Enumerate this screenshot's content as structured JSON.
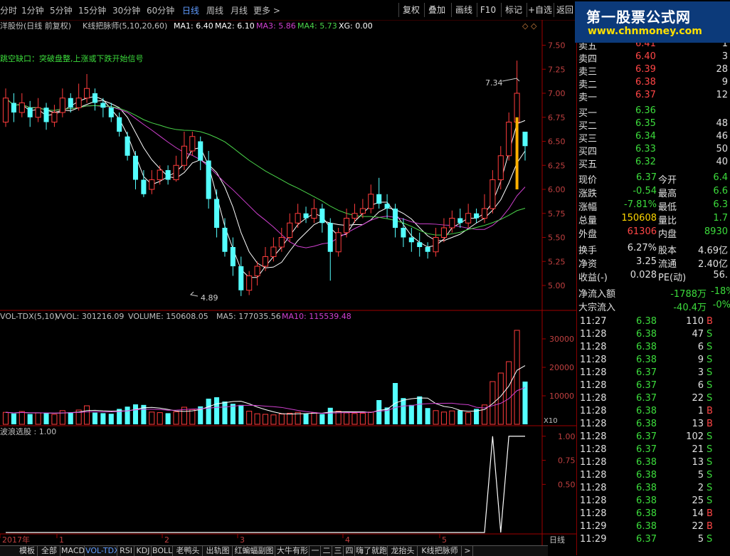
{
  "toolbar": {
    "periods": [
      "分时",
      "1分钟",
      "5分钟",
      "15分钟",
      "30分钟",
      "60分钟",
      "日线",
      "周线",
      "月线",
      "更多 >"
    ],
    "active_period": "日线",
    "buttons": [
      "复权",
      "叠加",
      "画线",
      "F10",
      "标记",
      "+自选",
      "返回"
    ]
  },
  "watermark": {
    "title": "第一股票公式网",
    "url": "www.chnmoney.com"
  },
  "main_chart": {
    "title": "洋股份(日线 前复权)",
    "indicator": "K线把脉师(5,10,20,60)",
    "ma": [
      {
        "label": "MA1: 6.40",
        "color": "#ffffff"
      },
      {
        "label": "MA2: 6.10",
        "color": "#ffffff"
      },
      {
        "label": "MA3: 5.86",
        "color": "#d040d0"
      },
      {
        "label": "MA4: 5.73",
        "color": "#4ad44a"
      },
      {
        "label": "XG: 0.00",
        "color": "#ffffff"
      }
    ],
    "signal_text": "跳空缺口：突破盘整,上涨或下跌开始信号",
    "high_label": "7.34",
    "low_label": "4.89",
    "y_ticks": [
      "7.50",
      "7.25",
      "7.00",
      "6.75",
      "6.50",
      "6.25",
      "6.00",
      "5.75",
      "5.50",
      "5.25",
      "5.00"
    ]
  },
  "chart_data": [
    {
      "type": "candlestick",
      "title": "洋股份(日线 前复权)",
      "ylim": [
        4.8,
        7.6
      ],
      "annotations": [
        {
          "text": "7.34",
          "value": 7.34
        },
        {
          "text": "4.89",
          "value": 4.89
        }
      ],
      "candles": [
        [
          6.7,
          6.95,
          7.05,
          6.65
        ],
        [
          6.9,
          6.8,
          7.0,
          6.7
        ],
        [
          6.8,
          6.9,
          7.0,
          6.75
        ],
        [
          6.85,
          6.75,
          6.92,
          6.65
        ],
        [
          6.75,
          6.85,
          6.95,
          6.7
        ],
        [
          6.85,
          6.7,
          6.9,
          6.62
        ],
        [
          6.7,
          6.8,
          6.88,
          6.65
        ],
        [
          6.8,
          6.95,
          7.05,
          6.75
        ],
        [
          6.95,
          6.85,
          7.0,
          6.8
        ],
        [
          6.85,
          6.95,
          7.1,
          6.82
        ],
        [
          6.95,
          7.05,
          7.2,
          6.9
        ],
        [
          7.0,
          6.9,
          7.05,
          6.82
        ],
        [
          6.9,
          6.85,
          6.95,
          6.75
        ],
        [
          6.85,
          6.75,
          6.9,
          6.7
        ],
        [
          6.75,
          6.6,
          6.8,
          6.55
        ],
        [
          6.55,
          6.35,
          6.6,
          6.3
        ],
        [
          6.35,
          6.1,
          6.4,
          6.0
        ],
        [
          6.1,
          5.95,
          6.2,
          5.92
        ],
        [
          6.0,
          6.1,
          6.2,
          5.95
        ],
        [
          6.1,
          6.2,
          6.25,
          6.05
        ],
        [
          6.2,
          6.1,
          6.25,
          6.05
        ],
        [
          6.1,
          6.25,
          6.35,
          6.08
        ],
        [
          6.25,
          6.45,
          6.6,
          6.2
        ],
        [
          6.4,
          6.55,
          6.6,
          6.35
        ],
        [
          6.5,
          6.3,
          6.55,
          6.2
        ],
        [
          6.3,
          5.9,
          6.4,
          5.8
        ],
        [
          5.9,
          5.6,
          6.0,
          5.5
        ],
        [
          5.6,
          5.35,
          5.7,
          5.3
        ],
        [
          5.4,
          5.2,
          5.5,
          5.1
        ],
        [
          5.2,
          4.95,
          5.3,
          4.89
        ],
        [
          4.95,
          5.1,
          5.15,
          4.9
        ],
        [
          5.1,
          5.2,
          5.25,
          5.0
        ],
        [
          5.2,
          5.3,
          5.4,
          5.15
        ],
        [
          5.3,
          5.4,
          5.5,
          5.25
        ],
        [
          5.4,
          5.5,
          5.6,
          5.35
        ],
        [
          5.5,
          5.65,
          5.75,
          5.45
        ],
        [
          5.65,
          5.75,
          5.85,
          5.6
        ],
        [
          5.75,
          5.7,
          5.82,
          5.65
        ],
        [
          5.7,
          5.8,
          5.9,
          5.65
        ],
        [
          5.8,
          5.65,
          5.85,
          5.55
        ],
        [
          5.65,
          5.35,
          5.7,
          5.05
        ],
        [
          5.35,
          5.55,
          5.6,
          5.3
        ],
        [
          5.55,
          5.7,
          5.8,
          5.5
        ],
        [
          5.7,
          5.75,
          5.85,
          5.65
        ],
        [
          5.75,
          5.8,
          5.9,
          5.7
        ],
        [
          5.8,
          5.95,
          6.05,
          5.75
        ],
        [
          5.95,
          5.85,
          6.12,
          5.8
        ],
        [
          5.85,
          5.8,
          5.95,
          5.7
        ],
        [
          5.8,
          5.6,
          5.85,
          5.5
        ],
        [
          5.6,
          5.5,
          5.7,
          5.4
        ],
        [
          5.5,
          5.45,
          5.6,
          5.35
        ],
        [
          5.45,
          5.4,
          5.55,
          5.3
        ],
        [
          5.4,
          5.35,
          5.45,
          5.28
        ],
        [
          5.35,
          5.5,
          5.6,
          5.3
        ],
        [
          5.5,
          5.6,
          5.7,
          5.45
        ],
        [
          5.6,
          5.7,
          5.78,
          5.55
        ],
        [
          5.7,
          5.65,
          5.8,
          5.6
        ],
        [
          5.65,
          5.75,
          5.85,
          5.6
        ],
        [
          5.75,
          5.7,
          5.8,
          5.65
        ],
        [
          5.7,
          5.8,
          5.95,
          5.65
        ],
        [
          5.8,
          6.1,
          6.2,
          5.75
        ],
        [
          6.1,
          6.35,
          6.45,
          6.0
        ],
        [
          6.35,
          6.7,
          6.8,
          6.3
        ],
        [
          6.7,
          7.0,
          7.34,
          6.7
        ],
        [
          6.6,
          6.45,
          6.6,
          6.3
        ]
      ]
    },
    {
      "type": "bar",
      "title": "VOL-TDX(5,10)",
      "labels": {
        "vol": "VVOL: 301216.09",
        "volume": "VOLUME: 150608.05",
        "ma5": "MA5: 177035.56",
        "ma10": "MA10: 115539.48"
      },
      "ylim": [
        0,
        35000
      ],
      "y_ticks": [
        "30000",
        "20000",
        "10000"
      ],
      "unit": "X10",
      "values": [
        4200,
        3800,
        4500,
        3600,
        4000,
        3900,
        3500,
        4800,
        4200,
        5000,
        6500,
        4100,
        3900,
        3700,
        5400,
        6200,
        7000,
        6800,
        4300,
        4100,
        3900,
        4400,
        6000,
        5200,
        6300,
        9000,
        9500,
        8000,
        7200,
        6800,
        4600,
        3700,
        3500,
        3300,
        3600,
        3900,
        4200,
        3800,
        4100,
        3600,
        5800,
        4600,
        4000,
        3800,
        3900,
        4300,
        8500,
        5900,
        14500,
        9200,
        6800,
        9800,
        5700,
        4800,
        4300,
        4700,
        4900,
        4100,
        5400,
        6800,
        15000,
        18000,
        22000,
        33000,
        15000
      ]
    },
    {
      "type": "line",
      "title": "波浪选股",
      "value_label": "波浪选股 : 1.00",
      "ylim": [
        0,
        1.05
      ],
      "y_ticks": [
        "1.00",
        "0.75",
        "0.50"
      ]
    }
  ],
  "axis_dates": [
    "2017年",
    "1",
    "2",
    "3",
    "4",
    "5"
  ],
  "axis_right_label": "日线",
  "right_panel": {
    "asks": [
      {
        "label": "卖五",
        "price": "6.41",
        "vol": "1"
      },
      {
        "label": "卖四",
        "price": "6.40",
        "vol": "3"
      },
      {
        "label": "卖三",
        "price": "6.39",
        "vol": "28"
      },
      {
        "label": "卖二",
        "price": "6.38",
        "vol": "9"
      },
      {
        "label": "卖一",
        "price": "6.37",
        "vol": "12"
      }
    ],
    "bids": [
      {
        "label": "买一",
        "price": "6.36",
        "vol": ""
      },
      {
        "label": "买二",
        "price": "6.35",
        "vol": "48"
      },
      {
        "label": "买三",
        "price": "6.34",
        "vol": "46"
      },
      {
        "label": "买四",
        "price": "6.33",
        "vol": "50"
      },
      {
        "label": "买五",
        "price": "6.32",
        "vol": "40"
      }
    ],
    "stats": [
      {
        "k1": "现价",
        "v1": "6.37",
        "k2": "今开",
        "v2": "6.4"
      },
      {
        "k1": "涨跌",
        "v1": "-0.54",
        "k2": "最高",
        "v2": "6.6"
      },
      {
        "k1": "涨幅",
        "v1": "-7.81%",
        "k2": "最低",
        "v2": "6.3"
      },
      {
        "k1": "总量",
        "v1": "150608",
        "k2": "量比",
        "v2": "1.7"
      },
      {
        "k1": "外盘",
        "v1": "61306",
        "k2": "内盘",
        "v2": "8930"
      }
    ],
    "stats2": [
      {
        "k1": "换手",
        "v1": "6.27%",
        "k2": "股本",
        "v2": "4.69亿"
      },
      {
        "k1": "净资",
        "v1": "3.25",
        "k2": "流通",
        "v2": "2.40亿"
      },
      {
        "k1": "收益(-)",
        "v1": "0.028",
        "k2": "PE(动)",
        "v2": "56."
      }
    ],
    "flows": [
      {
        "k": "净流入额",
        "v1": "-1788万",
        "v2": "-18%"
      },
      {
        "k": "大宗流入",
        "v1": "-40.4万",
        "v2": "-0%"
      }
    ],
    "ticks": [
      {
        "t": "11:27",
        "p": "6.38",
        "v": "110",
        "s": "B"
      },
      {
        "t": "11:28",
        "p": "6.38",
        "v": "47",
        "s": "S"
      },
      {
        "t": "11:28",
        "p": "6.38",
        "v": "6",
        "s": "S"
      },
      {
        "t": "11:28",
        "p": "6.38",
        "v": "9",
        "s": "S"
      },
      {
        "t": "11:28",
        "p": "6.37",
        "v": "3",
        "s": "S"
      },
      {
        "t": "11:28",
        "p": "6.37",
        "v": "6",
        "s": "S"
      },
      {
        "t": "11:28",
        "p": "6.37",
        "v": "22",
        "s": "S"
      },
      {
        "t": "11:28",
        "p": "6.38",
        "v": "1",
        "s": "B"
      },
      {
        "t": "11:28",
        "p": "6.38",
        "v": "13",
        "s": "B"
      },
      {
        "t": "11:28",
        "p": "6.37",
        "v": "102",
        "s": "S"
      },
      {
        "t": "11:28",
        "p": "6.37",
        "v": "21",
        "s": "S"
      },
      {
        "t": "11:28",
        "p": "6.38",
        "v": "13",
        "s": "S"
      },
      {
        "t": "11:28",
        "p": "6.38",
        "v": "5",
        "s": "S"
      },
      {
        "t": "11:28",
        "p": "6.38",
        "v": "2",
        "s": "S"
      },
      {
        "t": "11:28",
        "p": "6.38",
        "v": "25",
        "s": "S"
      },
      {
        "t": "11:28",
        "p": "6.38",
        "v": "14",
        "s": "B"
      },
      {
        "t": "11:29",
        "p": "6.38",
        "v": "22",
        "s": "B"
      },
      {
        "t": "11:29",
        "p": "6.37",
        "v": "5",
        "s": "S"
      }
    ]
  },
  "bottom_tabs": [
    "模板",
    "全部",
    "MACD",
    "VOL-TDX",
    "RSI",
    "KDJ",
    "BOLL",
    "老鸭头",
    "出轨图",
    "红蝙蝠副图",
    "大牛有形",
    "一",
    "二",
    "三",
    "四",
    "嗨了就跑",
    "龙抬头",
    "K线把脉师",
    ">"
  ],
  "colors": {
    "up": "#ff3c3c",
    "down": "#54ffff",
    "ma1": "#ffffff",
    "ma3": "#d040d0",
    "ma4": "#4ad44a",
    "border": "#a00000"
  }
}
